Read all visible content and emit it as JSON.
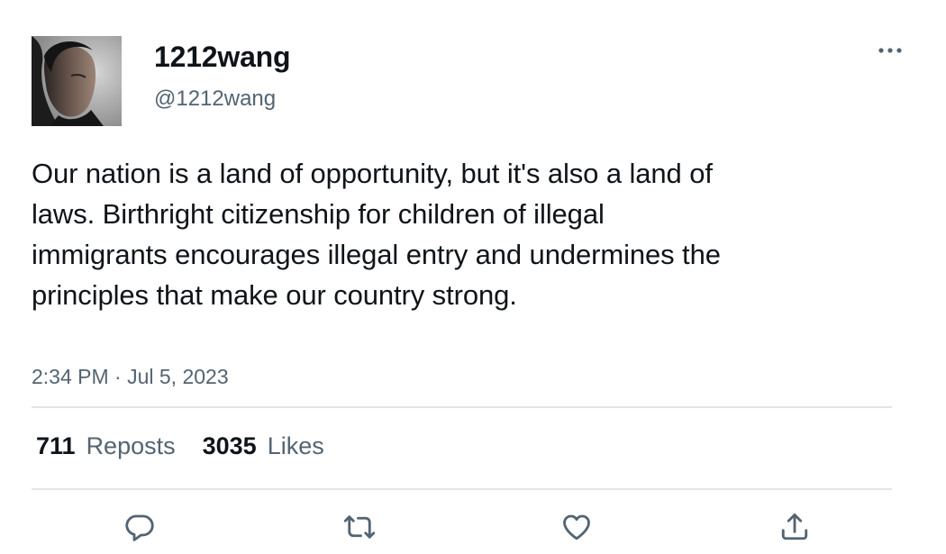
{
  "author": {
    "display_name": "1212wang",
    "handle": "@1212wang"
  },
  "tweet": {
    "text": "Our nation is a land of opportunity, but it's also a land of laws. Birthright citizenship for children of illegal immigrants encourages illegal entry and undermines the principles that make our country strong.",
    "timestamp": "2:34 PM · Jul 5, 2023"
  },
  "stats": {
    "reposts_count": "711",
    "reposts_label": "Reposts",
    "likes_count": "3035",
    "likes_label": "Likes"
  },
  "icons": {
    "more": "more-horizontal-icon",
    "reply": "reply-icon",
    "repost": "repost-icon",
    "like": "heart-icon",
    "share": "share-icon"
  },
  "colors": {
    "text": "#0f1419",
    "secondary_text": "#536471",
    "divider": "#e3e5e8",
    "icon": "#536471"
  }
}
